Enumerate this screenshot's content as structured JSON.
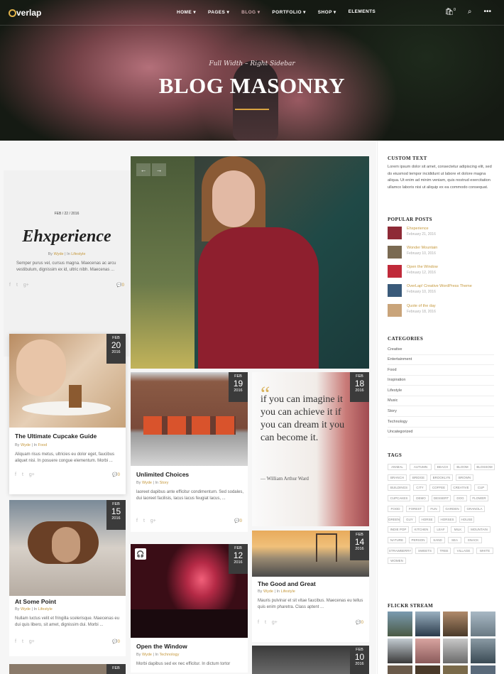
{
  "header": {
    "logo": "verlap",
    "nav": [
      "HOME",
      "PAGES",
      "BLOG",
      "PORTFOLIO",
      "SHOP",
      "ELEMENTS"
    ],
    "cart_count": "0"
  },
  "hero": {
    "subtitle": "Full Width – Right Sidebar",
    "title": "BLOG MASONRY"
  },
  "slider": {
    "prev": "←",
    "next": "→"
  },
  "featured": {
    "date": "FEB / 22 / 2016",
    "title": "Ehxperience",
    "author": "Wyde",
    "category": "Lifestyle",
    "excerpt": "Semper purus vel, cursus magna. Maecenas ac arcu vestibulum, dignissim ex id, ultric nibh. Maecenas ...",
    "comments": "0"
  },
  "posts": [
    {
      "month": "FEB",
      "day": "20",
      "year": "2016",
      "title": "The Ultimate Cupcake Guide",
      "author": "Wyde",
      "category": "Food",
      "excerpt": "Aliquam risus metus, ultricies eu dolor eget, faucibus aliquet nisi. In posuere congue elementum. Morbi ...",
      "comments": "0"
    },
    {
      "month": "FEB",
      "day": "19",
      "year": "2016",
      "title": "Unlimited Choices",
      "author": "Wyde",
      "category": "Story",
      "excerpt": "laoreet dapibus ante efficitur condimentum. Sed sodales, dui laoreet facilisis, lacus lacus feugiat lacus, ...",
      "comments": "0"
    },
    {
      "month": "FEB",
      "day": "18",
      "year": "2016",
      "quote": "if you can imagine it you can achieve it if you can dream it you can become it.",
      "quote_author": "— William Arthur Ward"
    },
    {
      "month": "FEB",
      "day": "15",
      "year": "2016",
      "title": "At Some Point",
      "author": "Wyde",
      "category": "Lifestyle",
      "excerpt": "Nullam luctus velit et fringilla scelerisque. Maecenas eu dui quis libero, sit amet, dignissim dui. Morbi ...",
      "comments": "0"
    },
    {
      "month": "FEB",
      "day": "14",
      "year": "2016",
      "title": "The Good and Great",
      "author": "Wyde",
      "category": "Lifestyle",
      "excerpt": "Mauris pulvinar et sit vitae faucibus. Maecenas eu tellus quis enim pharetra. Class aptent ...",
      "comments": "0"
    },
    {
      "month": "FEB",
      "day": "12",
      "year": "2016",
      "title": "Open the Window",
      "author": "Wyde",
      "category": "Technology",
      "excerpt": "Morbi dapibus sed ex nec efficitur. In dictum tortor",
      "comments": "0"
    },
    {
      "month": "FEB",
      "day": "10",
      "year": "2016"
    },
    {
      "month": "FEB"
    }
  ],
  "by_label": "By",
  "in_label": "In",
  "sidebar": {
    "custom_text_title": "CUSTOM TEXT",
    "custom_text": "Lorem ipsum dolor sit amet, consectetur adipiscing elit, sed do eiusmod tempor incididunt ut labore et dolore magna aliqua. Ut enim ad minim veniam, quis nostrud exercitation ullamco laboris nisi ut aliquip ex ea commodo consequat.",
    "popular_title": "POPULAR POSTS",
    "popular": [
      {
        "title": "Ehxperience",
        "date": "February 21, 2016"
      },
      {
        "title": "Wonder Mountain",
        "date": "February 10, 2016"
      },
      {
        "title": "Open the Window",
        "date": "February 12, 2016"
      },
      {
        "title": "OverLap! Creative WordPress Theme",
        "date": "February 10, 2016"
      },
      {
        "title": "Quote of the day",
        "date": "February 18, 2016"
      }
    ],
    "categories_title": "CATEGORIES",
    "categories": [
      "Creative",
      "Entertainment",
      "Food",
      "Inspiration",
      "Lifestyle",
      "Music",
      "Story",
      "Technology",
      "Uncategorized"
    ],
    "tags_title": "TAGS",
    "tags": [
      "ANIMAL",
      "AUTUMN",
      "BEACH",
      "BLOOM",
      "BLOSSOM",
      "BRANCH",
      "BRIDGE",
      "BROOKLYN",
      "BROWN",
      "BUILDINGS",
      "CITY",
      "COFFEE",
      "CREATIVE",
      "CUP",
      "CUPCAKES",
      "DEMO",
      "DESSERT",
      "DOG",
      "FLOWER",
      "FOOD",
      "FOREST",
      "FUN",
      "GARDEN",
      "GRANOLA",
      "GREEN",
      "GUY",
      "HORSE",
      "HORSES",
      "HOUSE",
      "INDIE POP",
      "KITCHEN",
      "LEAF",
      "MILK",
      "MOUNTAIN",
      "NATURE",
      "PERSON",
      "SAND",
      "SEA",
      "SNACK",
      "STRAWBERRY",
      "SWEETS",
      "TREE",
      "VILLAGE",
      "WHITE",
      "WOMEN"
    ],
    "flickr_title": "FLICKR STREAM"
  }
}
